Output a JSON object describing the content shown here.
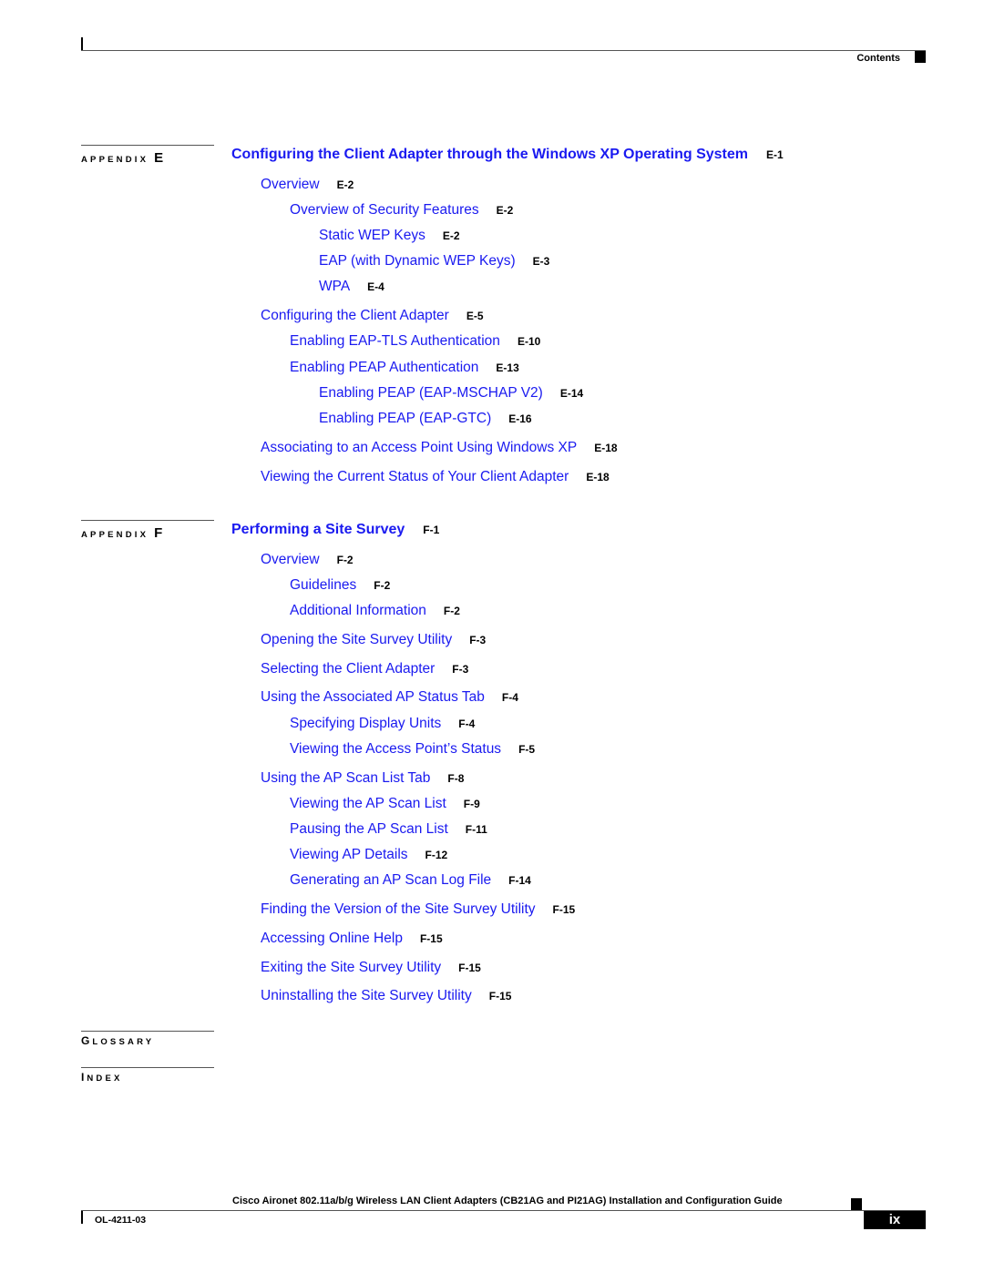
{
  "header": {
    "running_title": "Contents"
  },
  "appendices": [
    {
      "label_prefix": "APPENDIX",
      "letter": "E",
      "title": "Configuring the Client Adapter through the Windows XP Operating System",
      "page": "E-1",
      "entries": [
        {
          "text": "Overview",
          "page": "E-2",
          "level": 1
        },
        {
          "text": "Overview of Security Features",
          "page": "E-2",
          "level": 2
        },
        {
          "text": "Static WEP Keys",
          "page": "E-2",
          "level": 3
        },
        {
          "text": "EAP (with Dynamic WEP Keys)",
          "page": "E-3",
          "level": 3
        },
        {
          "text": "WPA",
          "page": "E-4",
          "level": 3
        },
        {
          "text": "Configuring the Client Adapter",
          "page": "E-5",
          "level": 1
        },
        {
          "text": "Enabling EAP-TLS Authentication",
          "page": "E-10",
          "level": 2
        },
        {
          "text": "Enabling PEAP Authentication",
          "page": "E-13",
          "level": 2
        },
        {
          "text": "Enabling PEAP (EAP-MSCHAP V2)",
          "page": "E-14",
          "level": 3
        },
        {
          "text": "Enabling PEAP (EAP-GTC)",
          "page": "E-16",
          "level": 3
        },
        {
          "text": "Associating to an Access Point Using Windows XP",
          "page": "E-18",
          "level": 1
        },
        {
          "text": "Viewing the Current Status of Your Client Adapter",
          "page": "E-18",
          "level": 1
        }
      ]
    },
    {
      "label_prefix": "APPENDIX",
      "letter": "F",
      "title": "Performing a Site Survey",
      "page": "F-1",
      "entries": [
        {
          "text": "Overview",
          "page": "F-2",
          "level": 1
        },
        {
          "text": "Guidelines",
          "page": "F-2",
          "level": 2
        },
        {
          "text": "Additional Information",
          "page": "F-2",
          "level": 2
        },
        {
          "text": "Opening the Site Survey Utility",
          "page": "F-3",
          "level": 1
        },
        {
          "text": "Selecting the Client Adapter",
          "page": "F-3",
          "level": 1
        },
        {
          "text": "Using the Associated AP Status Tab",
          "page": "F-4",
          "level": 1
        },
        {
          "text": "Specifying Display Units",
          "page": "F-4",
          "level": 2
        },
        {
          "text": "Viewing the Access Point’s Status",
          "page": "F-5",
          "level": 2
        },
        {
          "text": "Using the AP Scan List Tab",
          "page": "F-8",
          "level": 1
        },
        {
          "text": "Viewing the AP Scan List",
          "page": "F-9",
          "level": 2
        },
        {
          "text": "Pausing the AP Scan List",
          "page": "F-11",
          "level": 2
        },
        {
          "text": "Viewing AP Details",
          "page": "F-12",
          "level": 2
        },
        {
          "text": "Generating an AP Scan Log File",
          "page": "F-14",
          "level": 2
        },
        {
          "text": "Finding the Version of the Site Survey Utility",
          "page": "F-15",
          "level": 1
        },
        {
          "text": "Accessing Online Help",
          "page": "F-15",
          "level": 1
        },
        {
          "text": "Exiting the Site Survey Utility",
          "page": "F-15",
          "level": 1
        },
        {
          "text": "Uninstalling the Site Survey Utility",
          "page": "F-15",
          "level": 1
        }
      ]
    }
  ],
  "glossary": {
    "first": "G",
    "rest": "LOSSARY"
  },
  "index": {
    "first": "I",
    "rest": "NDEX"
  },
  "footer": {
    "book_title": "Cisco Aironet 802.11a/b/g Wireless LAN Client Adapters (CB21AG and PI21AG) Installation and Configuration Guide",
    "doc_number": "OL-4211-03",
    "page_number": "ix"
  }
}
